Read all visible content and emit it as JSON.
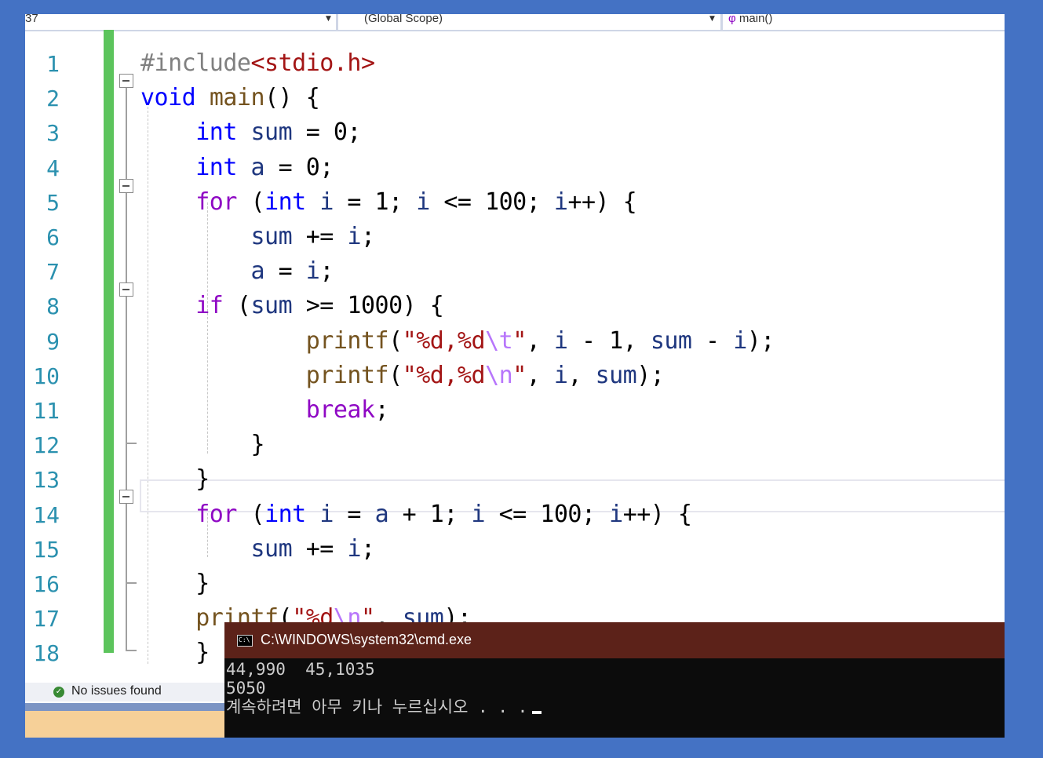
{
  "navbar": {
    "project": "37",
    "scope": "(Global Scope)",
    "function": "main()"
  },
  "editor": {
    "line_numbers": [
      "1",
      "2",
      "3",
      "4",
      "5",
      "6",
      "7",
      "8",
      "9",
      "10",
      "11",
      "12",
      "13",
      "14",
      "15",
      "16",
      "17",
      "18"
    ],
    "code_lines": [
      "#include<stdio.h>",
      "void main() {",
      "    int sum = 0;",
      "    int a = 0;",
      "    for (int i = 1; i <= 100; i++) {",
      "        sum += i;",
      "        a = i;",
      "    if (sum >= 1000) {",
      "            printf(\"%d,%d\\t\", i - 1, sum - i);",
      "            printf(\"%d,%d\\n\", i, sum);",
      "            break;",
      "        }",
      "    }",
      "    for (int i = a + 1; i <= 100; i++) {",
      "        sum += i;",
      "    }",
      "    printf(\"%d\\n\", sum);",
      "    }"
    ],
    "colors": {
      "keyword": "#0000ff",
      "control": "#8f08c4",
      "variable": "#1f377f",
      "function": "#74531f",
      "string": "#a31515",
      "escape": "#b776fb",
      "preprocessor": "#808080",
      "line_number": "#2b91af",
      "change_bar": "#5cc45c"
    }
  },
  "status": {
    "issues": "No issues found",
    "icon": "check-circle-icon"
  },
  "console": {
    "title": "C:\\WINDOWS\\system32\\cmd.exe",
    "icon_label": "C:\\",
    "output": [
      "44,990  45,1035",
      "5050",
      "계속하려면 아무 키나 누르십시오 . . ."
    ],
    "colors": {
      "title_bar": "#5c2219",
      "background": "#0c0c0c",
      "text": "#cccccc"
    }
  }
}
